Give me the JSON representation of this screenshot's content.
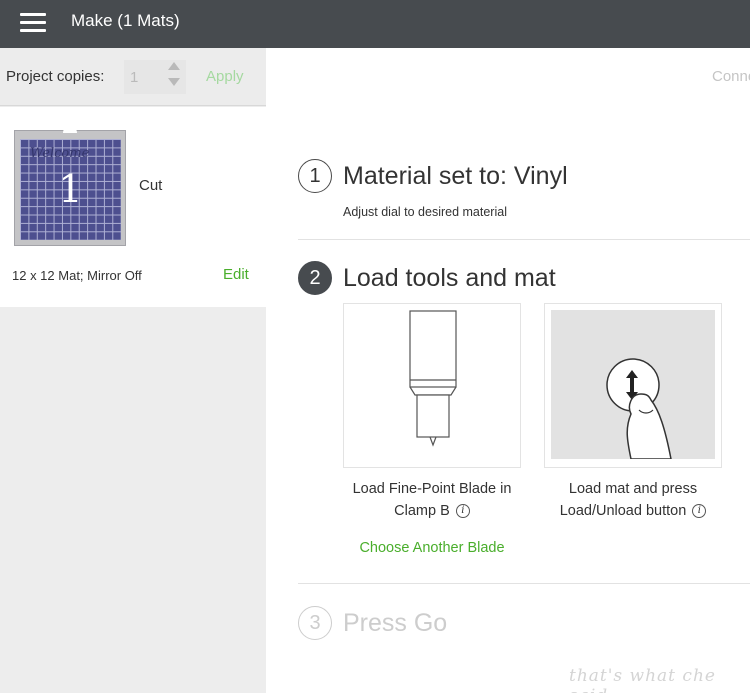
{
  "header": {
    "title": "Make (1 Mats)"
  },
  "sidebar": {
    "copies_label": "Project copies:",
    "copies_value": "1",
    "apply_label": "Apply",
    "mat": {
      "number": "1",
      "script_text": "Welcome",
      "operation": "Cut",
      "description": "12 x 12 Mat; Mirror Off",
      "edit_label": "Edit"
    }
  },
  "main": {
    "connect_label": "Conne",
    "steps": [
      {
        "number": "1",
        "title": "Material set to: Vinyl",
        "subtitle": "Adjust dial to desired material"
      },
      {
        "number": "2",
        "title": "Load tools and mat"
      },
      {
        "number": "3",
        "title": "Press Go"
      }
    ],
    "tools": {
      "blade_line1": "Load Fine-Point Blade in",
      "blade_line2": "Clamp B",
      "mat_line1": "Load mat and press",
      "mat_line2": "Load/Unload button",
      "info_glyph": "i",
      "choose_blade_label": "Choose Another Blade"
    }
  },
  "watermark": "that's what che said",
  "colors": {
    "topbar": "#474b4f",
    "accent_green": "#4aae2c",
    "apply_disabled": "#a5d9a0",
    "mat_blue": "#4d4f8f"
  },
  "icons": {
    "menu": "hamburger-menu-icon",
    "info": "info-icon",
    "blade": "fine-point-blade-icon",
    "load": "load-unload-button-icon"
  }
}
